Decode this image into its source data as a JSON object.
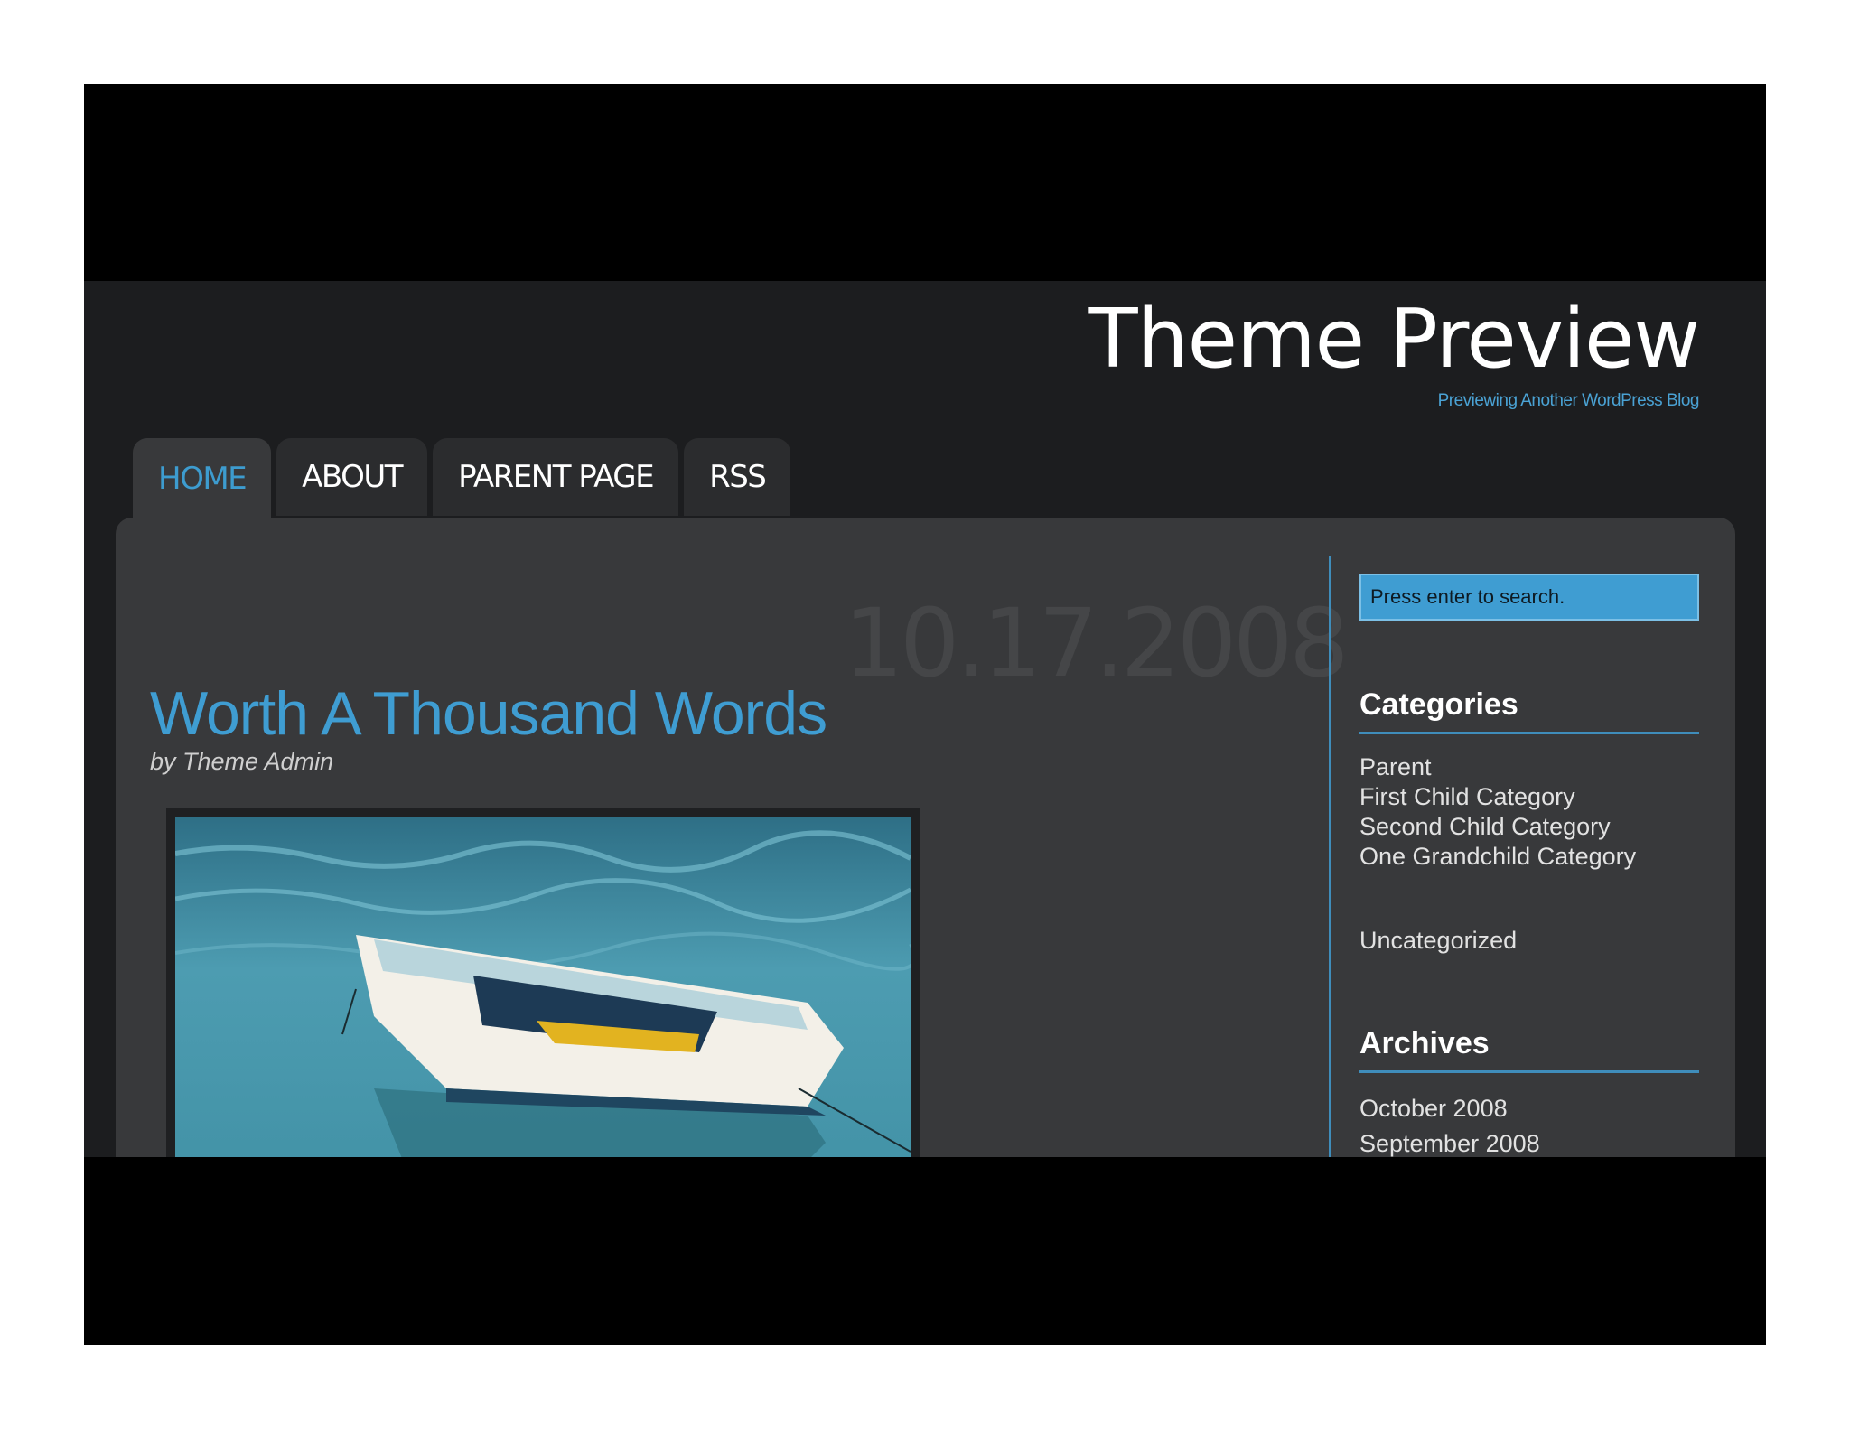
{
  "site": {
    "title": "Theme Preview",
    "tagline": "Previewing Another WordPress Blog"
  },
  "nav": {
    "tabs": [
      {
        "label": "HOME",
        "active": true
      },
      {
        "label": "ABOUT",
        "active": false
      },
      {
        "label": "PARENT PAGE",
        "active": false
      },
      {
        "label": "RSS",
        "active": false
      }
    ]
  },
  "post": {
    "date": "10.17.2008",
    "title": "Worth A Thousand Words",
    "byline": "by Theme Admin",
    "image_icon": "rowboat-photo"
  },
  "sidebar": {
    "search": {
      "placeholder": "Press enter to search."
    },
    "categories": {
      "title": "Categories",
      "items": [
        "Parent",
        "First Child Category",
        "Second Child Category",
        "One Grandchild Category",
        "Uncategorized"
      ]
    },
    "archives": {
      "title": "Archives",
      "items": [
        "October 2008",
        "September 2008"
      ]
    }
  },
  "colors": {
    "accent": "#3f9dd2",
    "background": "#1c1d1f",
    "panel": "#38393b"
  }
}
